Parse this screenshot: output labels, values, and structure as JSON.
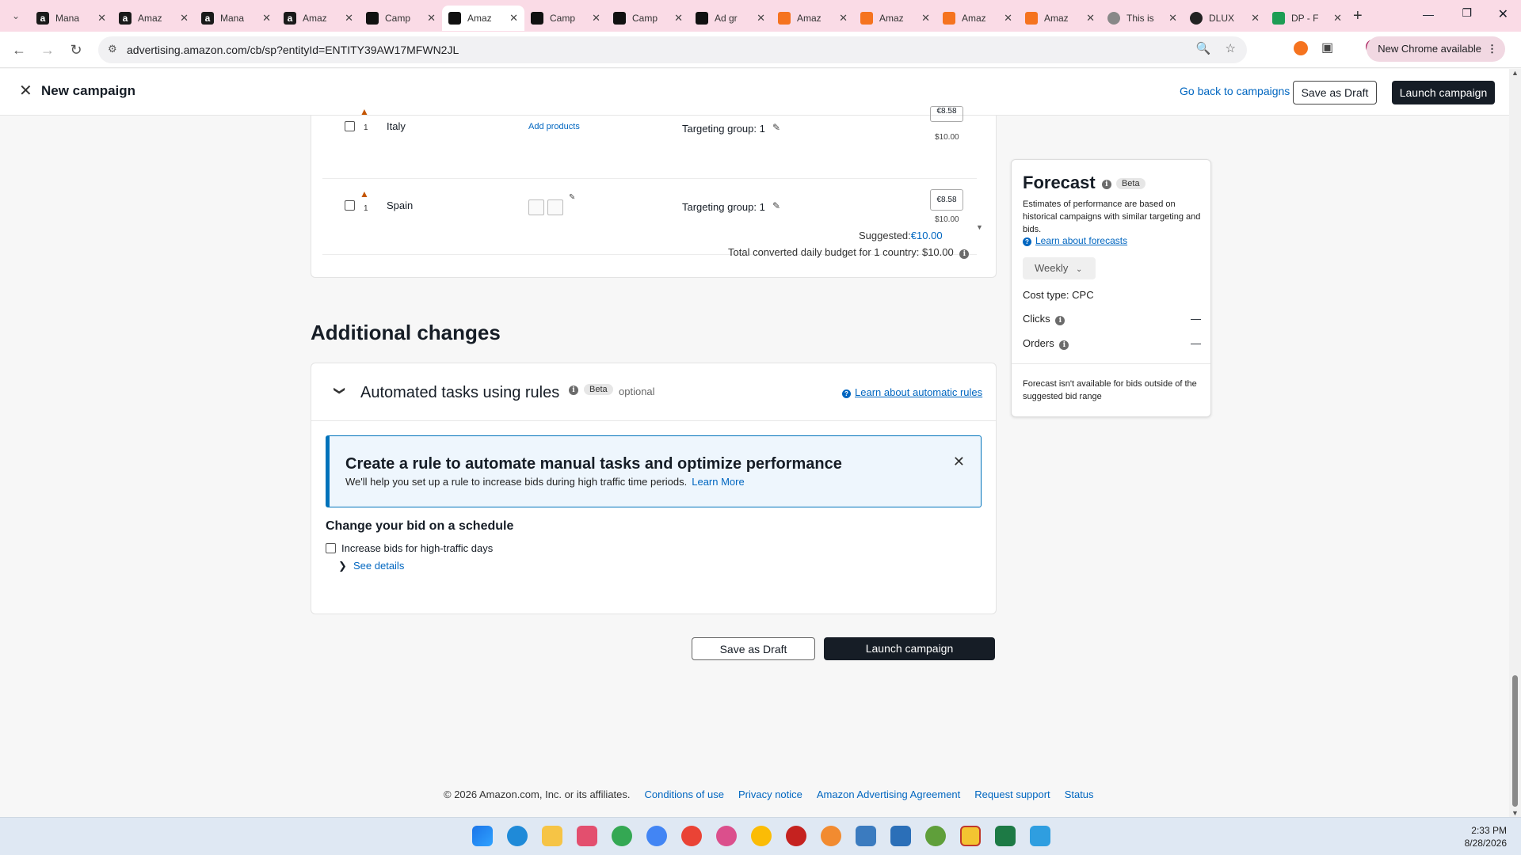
{
  "browser": {
    "tabs": [
      {
        "title": "Mana",
        "favicon": "amazon-icon",
        "active": false
      },
      {
        "title": "Amaz",
        "favicon": "amazon-icon",
        "active": false
      },
      {
        "title": "Mana",
        "favicon": "amazon-icon",
        "active": false
      },
      {
        "title": "Amaz",
        "favicon": "amazon-icon",
        "active": false
      },
      {
        "title": "Camp",
        "favicon": "mail-icon",
        "active": false
      },
      {
        "title": "Amaz",
        "favicon": "mail-icon",
        "active": true
      },
      {
        "title": "Camp",
        "favicon": "mail-icon",
        "active": false
      },
      {
        "title": "Camp",
        "favicon": "mail-icon",
        "active": false
      },
      {
        "title": "Ad gr",
        "favicon": "mail-icon",
        "active": false
      },
      {
        "title": "Amaz",
        "favicon": "orange-icon",
        "active": false
      },
      {
        "title": "Amaz",
        "favicon": "orange-icon",
        "active": false
      },
      {
        "title": "Amaz",
        "favicon": "orange-icon",
        "active": false
      },
      {
        "title": "Amaz",
        "favicon": "orange-icon",
        "active": false
      },
      {
        "title": "This is",
        "favicon": "grey-icon",
        "active": false
      },
      {
        "title": "DLUX",
        "favicon": "circle-icon",
        "active": false
      },
      {
        "title": "DP - F",
        "favicon": "sheet-icon",
        "active": false
      }
    ],
    "url": "advertising.amazon.com/cb/sp?entityId=ENTITY39AW17MFWN2JL",
    "new_chrome_label": "New Chrome available"
  },
  "header": {
    "title": "New campaign",
    "go_back": "Go back to campaigns",
    "save_draft": "Save as Draft",
    "launch": "Launch campaign"
  },
  "countries": {
    "rows": [
      {
        "num": "1",
        "country": "Italy",
        "products": "Add products",
        "targeting": "Targeting group: 1",
        "bid": "€8.58",
        "bid_sub": "$10.00"
      },
      {
        "num": "1",
        "country": "Spain",
        "products": "",
        "targeting": "Targeting group: 1",
        "bid": "€8.58",
        "bid_sub": "$10.00",
        "suggested_label": "Suggested:",
        "suggested_value": "€10.00"
      }
    ],
    "total_budget": "Total converted daily budget for 1 country: $10.00"
  },
  "forecast": {
    "title": "Forecast",
    "beta": "Beta",
    "description": "Estimates of performance are based on historical campaigns with similar targeting and bids.",
    "learn": "Learn about forecasts",
    "period": "Weekly",
    "cost_type": "Cost type: CPC",
    "clicks_label": "Clicks",
    "clicks_value": "—",
    "orders_label": "Orders",
    "orders_value": "—",
    "note": "Forecast isn't available for bids outside of the suggested bid range"
  },
  "additional": {
    "heading": "Additional changes",
    "rules_title": "Automated tasks using rules",
    "beta": "Beta",
    "optional": "optional",
    "learn": "Learn about automatic rules",
    "banner_title": "Create a rule to automate manual tasks and optimize performance",
    "banner_body": "We'll help you set up a rule to increase bids during high traffic time periods.",
    "banner_more": "Learn More",
    "schedule_title": "Change your bid on a schedule",
    "schedule_option": "Increase bids for high-traffic days",
    "see_details": "See details"
  },
  "bottom_actions": {
    "save_draft": "Save as Draft",
    "launch": "Launch campaign"
  },
  "footer": {
    "copyright": "© 2026 Amazon.com, Inc. or its affiliates.",
    "links": [
      "Conditions of use",
      "Privacy notice",
      "Amazon Advertising Agreement",
      "Request support",
      "Status"
    ]
  },
  "taskbar": {
    "time": "2:33 PM",
    "date": "8/28/2026"
  },
  "colors": {
    "accent_link": "#0066c0",
    "dark_button": "#161d26",
    "tab_strip": "#fadbe6",
    "banner_border": "#0073bb"
  }
}
